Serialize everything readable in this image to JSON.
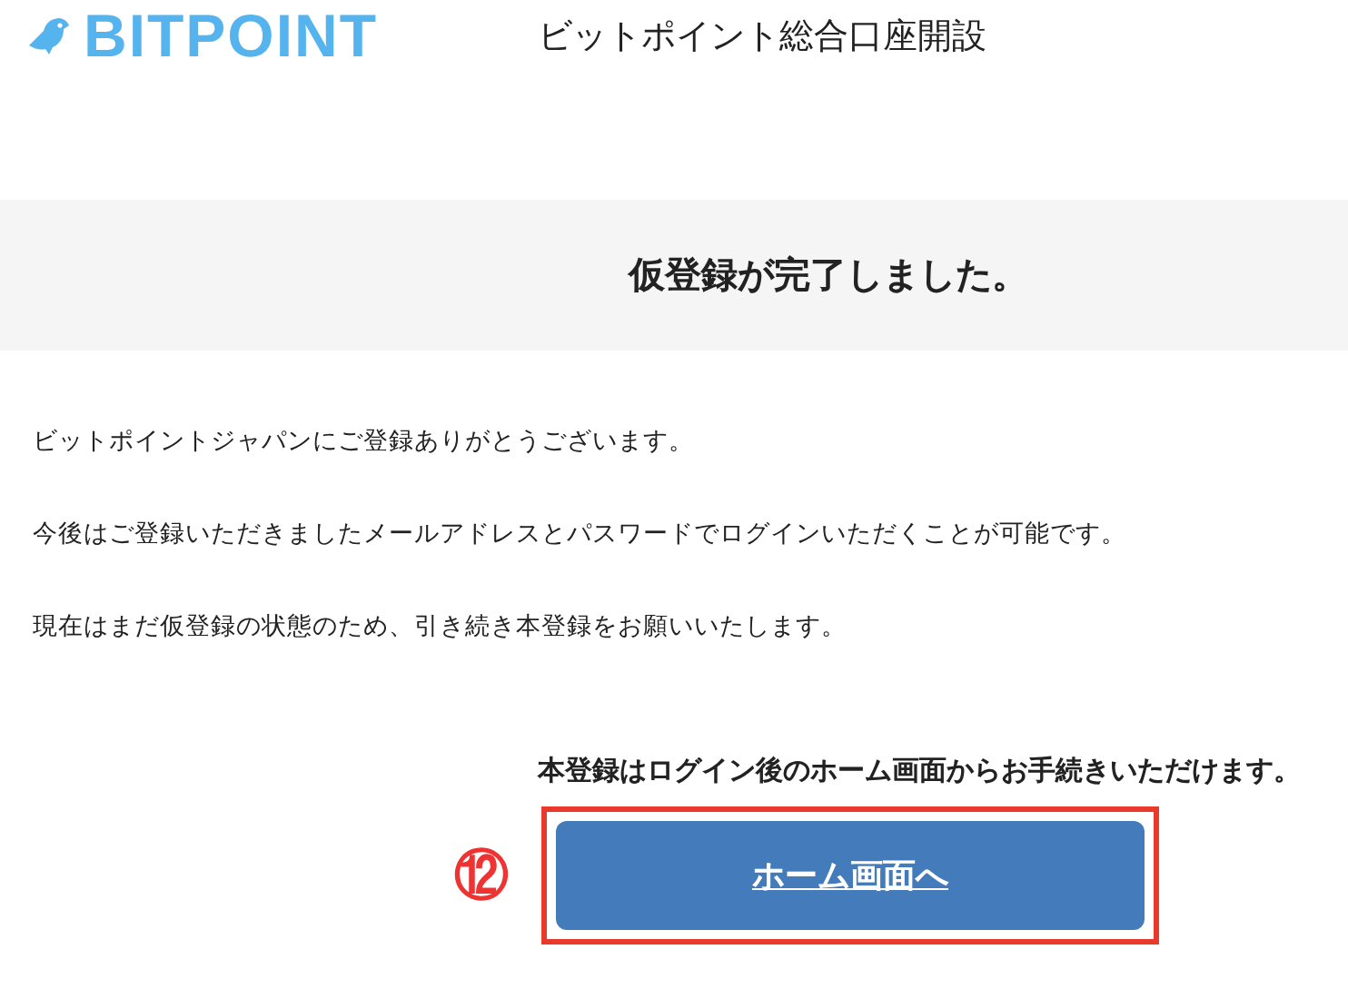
{
  "header": {
    "logo": "BITPOINT",
    "title": "ビットポイント総合口座開設"
  },
  "banner": {
    "heading": "仮登録が完了しました。"
  },
  "paragraphs": [
    "ビットポイントジャパンにご登録ありがとうございます。",
    "今後はご登録いただきましたメールアドレスとパスワードでログインいただくことが可能です。",
    "現在はまだ仮登録の状態のため、引き続き本登録をお願いいたします。"
  ],
  "note": "本登録はログイン後のホーム画面からお手続きいただけます。",
  "annotation": {
    "label": "⑫"
  },
  "button": {
    "label": "ホーム画面へ"
  }
}
